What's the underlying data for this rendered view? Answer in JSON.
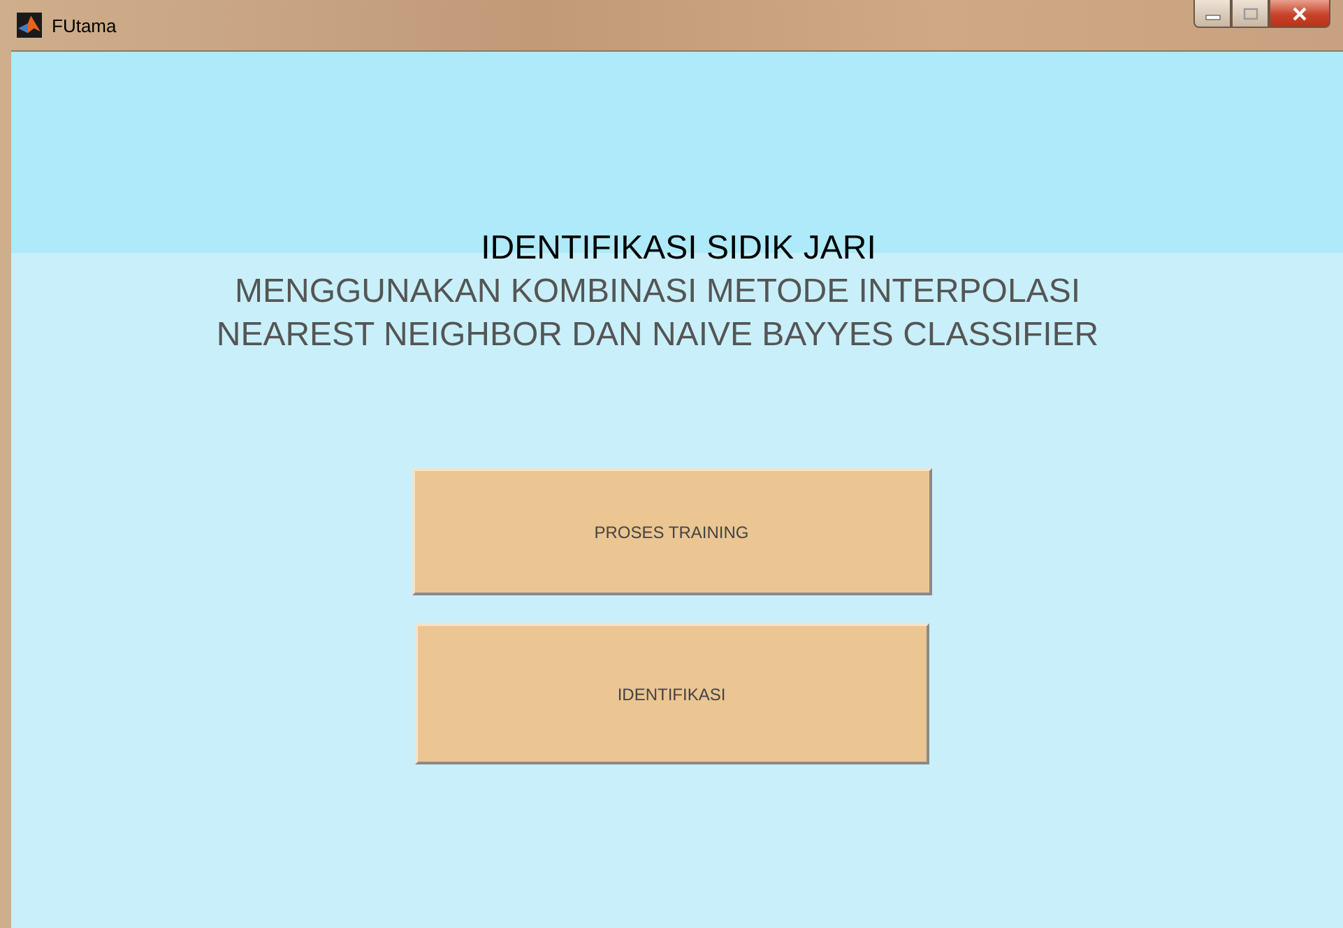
{
  "window": {
    "title": "FUtama"
  },
  "heading": {
    "title": "IDENTIFIKASI SIDIK JARI",
    "subtitle_lines": [
      "MENGGUNAKAN KOMBINASI METODE INTERPOLASI",
      "NEAREST NEIGHBOR DAN NAIVE BAYYES CLASSIFIER"
    ]
  },
  "buttons": [
    {
      "label": "PROSES TRAINING"
    },
    {
      "label": "IDENTIFIKASI"
    }
  ]
}
